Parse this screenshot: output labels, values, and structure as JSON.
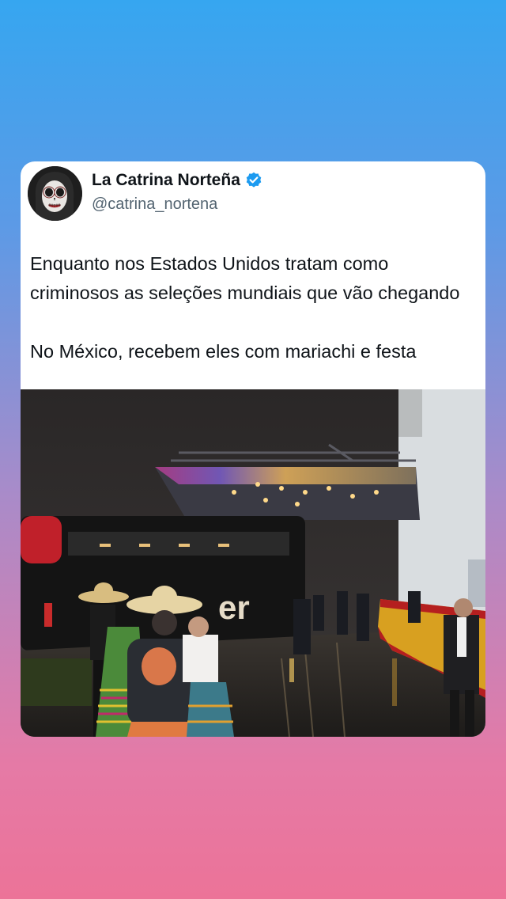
{
  "tweet": {
    "author_name": "La Catrina Norteña",
    "author_handle": "@catrina_nortena",
    "verified": true,
    "avatar_icon": "catrina-skull-avatar-icon",
    "verified_icon": "verified-badge-icon",
    "paragraph_1": "Enquanto nos Estados Unidos tratam como criminosos as seleções mundiais que vão chegando",
    "paragraph_2": "No México, recebem eles com mariachi e festa",
    "media_icon": "video-still-photo"
  },
  "colors": {
    "background_top": "#36a6f0",
    "background_bottom": "#ec7398",
    "card": "#ffffff",
    "text": "#0f1419",
    "handle": "#536471",
    "verified": "#1d9bf0"
  }
}
